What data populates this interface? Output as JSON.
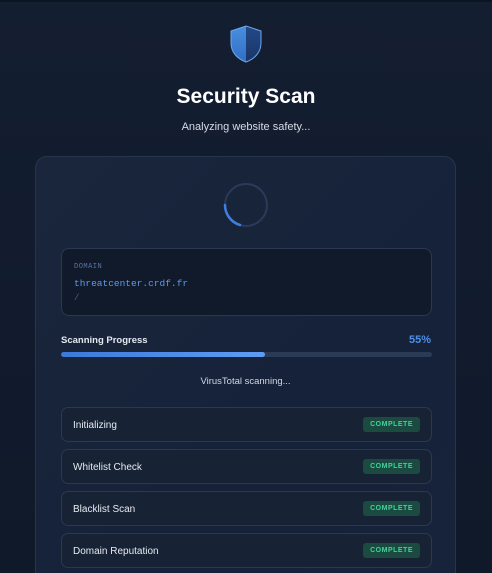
{
  "header": {
    "title": "Security Scan",
    "subtitle": "Analyzing website safety..."
  },
  "domain_box": {
    "label": "DOMAIN",
    "value": "threatcenter.crdf.fr",
    "path": "/"
  },
  "progress": {
    "label": "Scanning Progress",
    "percent_text": "55%",
    "value": 0.55,
    "status": "VirusTotal scanning..."
  },
  "steps": [
    {
      "label": "Initializing",
      "status": "COMPLETE"
    },
    {
      "label": "Whitelist Check",
      "status": "COMPLETE"
    },
    {
      "label": "Blacklist Scan",
      "status": "COMPLETE"
    },
    {
      "label": "Domain Reputation",
      "status": "COMPLETE"
    }
  ],
  "colors": {
    "accent": "#4f8fe6",
    "success": "#3fd39a",
    "background": "#111b2d"
  },
  "icons": {
    "logo": "shield-icon",
    "loader": "spinner-icon"
  }
}
